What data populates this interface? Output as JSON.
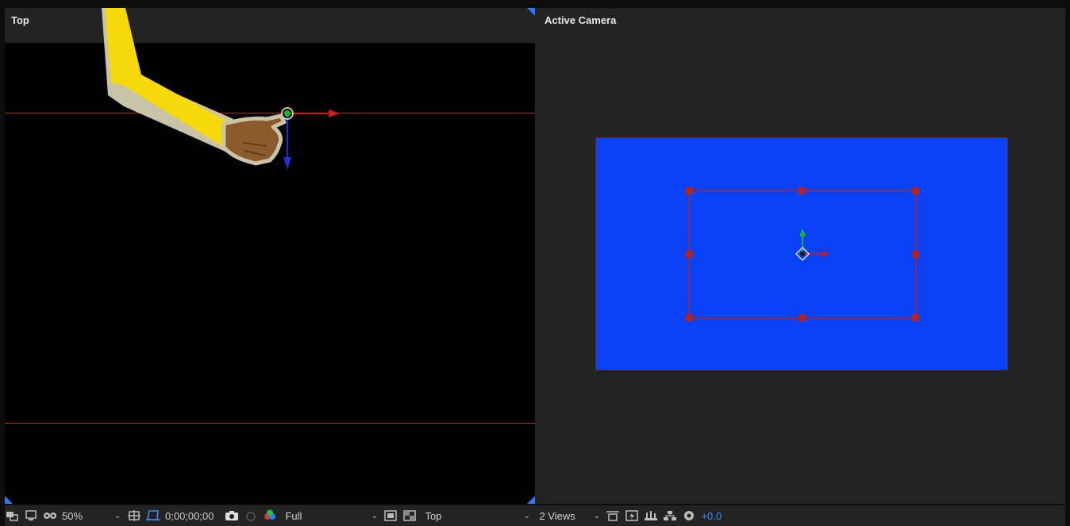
{
  "views": {
    "left": {
      "label": "Top"
    },
    "right": {
      "label": "Active Camera"
    }
  },
  "colors": {
    "comp_background": "#0841f6",
    "guide_line": "#b3231f",
    "arm_sleeve": "#f5d90a",
    "arm_outline": "#c9c3a8",
    "hand_skin": "#8b5a2b",
    "axis_x": "#cc1b1b",
    "axis_y": "#19b52a",
    "axis_z": "#1d2fd4",
    "accent_blue": "#3d8bff"
  },
  "toolbar": {
    "icons": [
      "always-preview-icon",
      "monitor-icon",
      "mask-visibility-icon"
    ],
    "zoom": "50%",
    "timecode": "0;00;00;00",
    "resolution": "Full",
    "view_layout_view": "Top",
    "view_count": "2 Views",
    "exposure": "+0.0"
  }
}
